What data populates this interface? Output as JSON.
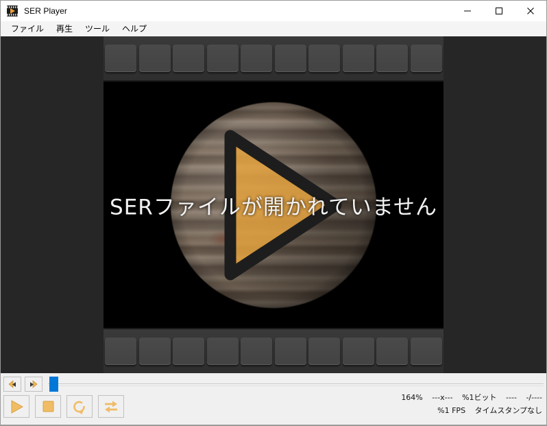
{
  "window": {
    "title": "SER Player",
    "icon": "film-play-icon",
    "buttons": {
      "minimize": "minimize-icon",
      "maximize": "maximize-icon",
      "close": "close-icon"
    }
  },
  "menubar": {
    "items": [
      {
        "label": "ファイル",
        "name": "menu-file"
      },
      {
        "label": "再生",
        "name": "menu-playback"
      },
      {
        "label": "ツール",
        "name": "menu-tools"
      },
      {
        "label": "ヘルプ",
        "name": "menu-help"
      }
    ]
  },
  "viewer": {
    "message": "SERファイルが開かれていません",
    "placeholder_graphic": "jupiter-play-placeholder",
    "sprocket_count": 10
  },
  "controls": {
    "step_back": {
      "label": "<",
      "name": "step-back-button"
    },
    "step_forward": {
      "label": ">",
      "name": "step-forward-button"
    },
    "slider": {
      "value": 0,
      "name": "frame-slider"
    },
    "play": {
      "name": "play-button"
    },
    "stop": {
      "name": "stop-button"
    },
    "repeat": {
      "name": "repeat-button"
    },
    "bounce": {
      "name": "bounce-button"
    }
  },
  "status": {
    "zoom": "164%",
    "resolution": "---x---",
    "bit_depth": "%1ビット",
    "colour": "----",
    "frame_counter": "-/----",
    "fps": "%1 FPS",
    "timestamp": "タイムスタンプなし"
  },
  "colors": {
    "accent_orange": "#e8a33d",
    "slider_blue": "#0078d7",
    "panel_bg": "#f0f0f0",
    "viewer_bg": "#262626",
    "film_gray": "#3a3a3a"
  }
}
